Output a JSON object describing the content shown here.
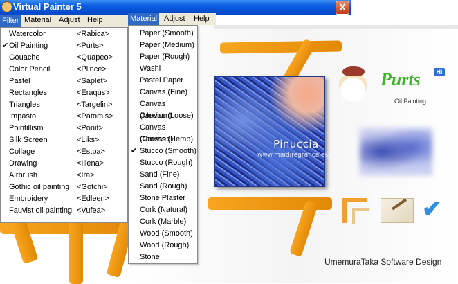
{
  "window": {
    "title": "Virtual Painter 5",
    "close_glyph": "X"
  },
  "menubar": {
    "items": [
      "Filter",
      "Material",
      "Adjust",
      "Help"
    ]
  },
  "menubar_material": {
    "items": [
      "Material",
      "Adjust",
      "Help"
    ]
  },
  "filter_menu": {
    "items": [
      {
        "label": "Watercolor",
        "shortcut": "<Rabica>",
        "checked": false
      },
      {
        "label": "Oil Painting",
        "shortcut": "<Purts>",
        "checked": true
      },
      {
        "label": "Gouache",
        "shortcut": "<Quapeo>",
        "checked": false
      },
      {
        "label": "Color Pencil",
        "shortcut": "<Plince>",
        "checked": false
      },
      {
        "label": "Pastel",
        "shortcut": "<Saplet>",
        "checked": false
      },
      {
        "label": "Rectangles",
        "shortcut": "<Eraqus>",
        "checked": false
      },
      {
        "label": "Triangles",
        "shortcut": "<Targelin>",
        "checked": false
      },
      {
        "label": "Impasto",
        "shortcut": "<Patomis>",
        "checked": false
      },
      {
        "label": "Pointillism",
        "shortcut": "<Ponit>",
        "checked": false
      },
      {
        "label": "Silk Screen",
        "shortcut": "<Liks>",
        "checked": false
      },
      {
        "label": "Collage",
        "shortcut": "<Estpa>",
        "checked": false
      },
      {
        "label": "Drawing",
        "shortcut": "<Illena>",
        "checked": false
      },
      {
        "label": "Airbrush",
        "shortcut": "<Ira>",
        "checked": false
      },
      {
        "label": "Gothic oil painting",
        "shortcut": "<Gotchi>",
        "checked": false
      },
      {
        "label": "Embroidery",
        "shortcut": "<Edleen>",
        "checked": false
      },
      {
        "label": "Fauvist oil painting",
        "shortcut": "<Vufea>",
        "checked": false
      }
    ]
  },
  "material_menu": {
    "items": [
      {
        "label": "Paper (Smooth)",
        "checked": false
      },
      {
        "label": "Paper (Medium)",
        "checked": false
      },
      {
        "label": "Paper (Rough)",
        "checked": false
      },
      {
        "label": "Washi",
        "checked": false
      },
      {
        "label": "Pastel Paper",
        "checked": false
      },
      {
        "label": "Canvas (Fine)",
        "checked": false
      },
      {
        "label": "Canvas (Medium)",
        "checked": false
      },
      {
        "label": "Canvas (Loose)",
        "checked": false
      },
      {
        "label": "Canvas (Crossed)",
        "checked": false
      },
      {
        "label": "Canvas (Hemp)",
        "checked": false
      },
      {
        "label": "Stucco (Smooth)",
        "checked": true
      },
      {
        "label": "Stucco (Rough)",
        "checked": false
      },
      {
        "label": "Sand (Fine)",
        "checked": false
      },
      {
        "label": "Sand (Rough)",
        "checked": false
      },
      {
        "label": "Stone Plaster",
        "checked": false
      },
      {
        "label": "Cork (Natural)",
        "checked": false
      },
      {
        "label": "Cork (Marble)",
        "checked": false
      },
      {
        "label": "Wood (Smooth)",
        "checked": false
      },
      {
        "label": "Wood (Rough)",
        "checked": false
      },
      {
        "label": "Stone",
        "checked": false
      }
    ]
  },
  "painting": {
    "watermark_name": "Pinuccia",
    "watermark_url": "www.maidiregrafica.eu"
  },
  "brand": {
    "logo_text": "Purts",
    "logo_badge": "Hi",
    "subtitle": "Oil Painting"
  },
  "credit": "UmemuraTaka Software Design",
  "colors": {
    "titlebar": "#0a5ee0",
    "menu_highlight": "#316ac5",
    "easel": "#f29a16",
    "logo_green": "#3db42a"
  },
  "icons": {
    "check": "checkmark-icon",
    "frame_tool": "frame-icon",
    "signature_tool": "signature-icon",
    "ok_tool": "ok-check-icon"
  }
}
